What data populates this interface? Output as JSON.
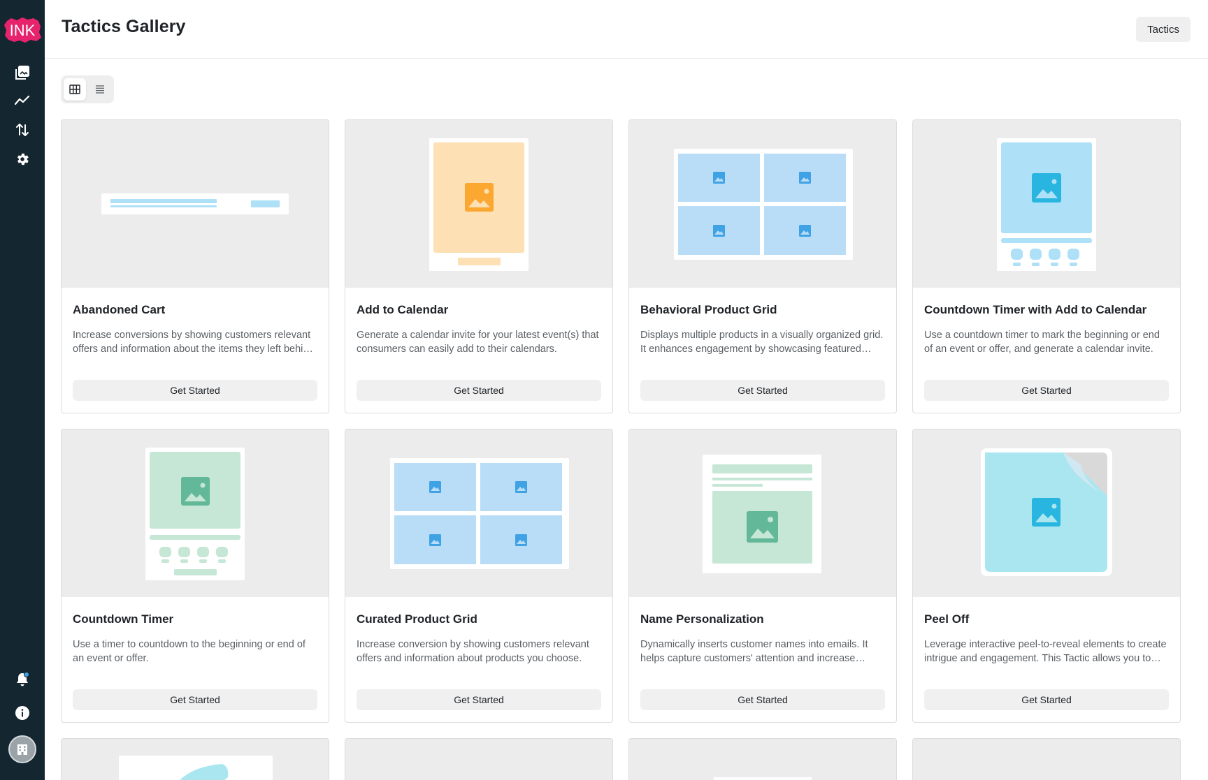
{
  "app": {
    "logo_text": "INK"
  },
  "header": {
    "title": "Tactics Gallery",
    "button_label": "Tactics"
  },
  "sidebar": {
    "items": [
      {
        "icon": "gallery-icon"
      },
      {
        "icon": "analytics-icon"
      },
      {
        "icon": "sort-arrows-icon"
      },
      {
        "icon": "gear-icon"
      }
    ],
    "bottom": [
      {
        "icon": "bell-icon",
        "has_dot": true
      },
      {
        "icon": "info-icon"
      },
      {
        "icon": "building-icon"
      }
    ]
  },
  "view_toggle": {
    "options": [
      "grid-icon",
      "list-icon"
    ],
    "selected": "grid"
  },
  "cards": [
    {
      "title": "Abandoned Cart",
      "description": "Increase conversions by showing customers relevant offers and information about the items they left behind in their cart.",
      "button": "Get Started"
    },
    {
      "title": "Add to Calendar",
      "description": "Generate a calendar invite for your latest event(s) that consumers can easily add to their calendars.",
      "button": "Get Started"
    },
    {
      "title": "Behavioral Product Grid",
      "description": "Displays multiple products in a visually organized grid. It enhances engagement by showcasing featured products.",
      "button": "Get Started"
    },
    {
      "title": "Countdown Timer with Add to Calendar",
      "description": "Use a countdown timer to mark the beginning or end of an event or offer, and generate a calendar invite.",
      "button": "Get Started"
    },
    {
      "title": "Countdown Timer",
      "description": "Use a timer to countdown to the beginning or end of an event or offer.",
      "button": "Get Started"
    },
    {
      "title": "Curated Product Grid",
      "description": "Increase conversion by showing customers relevant offers and information about products you choose.",
      "button": "Get Started"
    },
    {
      "title": "Name Personalization",
      "description": "Dynamically inserts customer names into emails. It helps capture customers' attention and increase engagement.",
      "button": "Get Started"
    },
    {
      "title": "Peel Off",
      "description": "Leverage interactive peel-to-reveal elements to create intrigue and engagement. This Tactic allows you to hide content.",
      "button": "Get Started"
    }
  ],
  "colors": {
    "sidebar_bg": "#14262f",
    "logo_pink": "#e6236c",
    "light_blue": "#aee0f8",
    "blue_tile": "#b9dcf7",
    "blue_icon": "#3fa2e4",
    "orange_bg": "#fde0b3",
    "orange_icon": "#fba730",
    "green_bg": "#c6e6d6",
    "green_icon": "#62b899",
    "cyan_bg": "#a9e6f0",
    "cyan_icon": "#28b6e0"
  }
}
